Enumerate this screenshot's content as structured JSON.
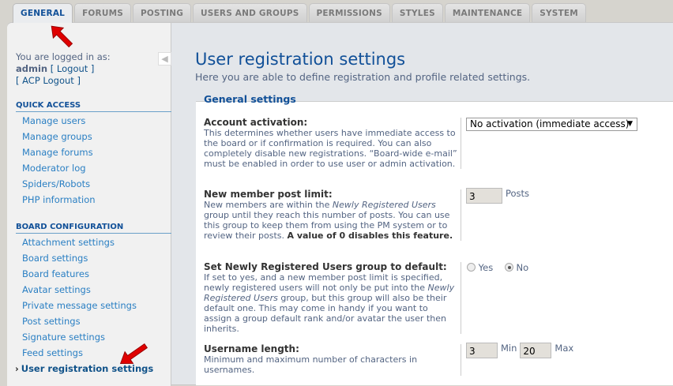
{
  "tabs": [
    "GENERAL",
    "FORUMS",
    "POSTING",
    "USERS AND GROUPS",
    "PERMISSIONS",
    "STYLES",
    "MAINTENANCE",
    "SYSTEM"
  ],
  "login": {
    "prefix": "You are logged in as:",
    "user": "admin",
    "logout": "[ Logout ]",
    "acp_logout": "[ ACP Logout ]"
  },
  "sidebar": {
    "quick_access": {
      "title": "QUICK ACCESS",
      "items": [
        "Manage users",
        "Manage groups",
        "Manage forums",
        "Moderator log",
        "Spiders/Robots",
        "PHP information"
      ]
    },
    "board_config": {
      "title": "BOARD CONFIGURATION",
      "items": [
        "Attachment settings",
        "Board settings",
        "Board features",
        "Avatar settings",
        "Private message settings",
        "Post settings",
        "Signature settings",
        "Feed settings",
        "User registration settings"
      ]
    }
  },
  "main": {
    "title": "User registration settings",
    "intro": "Here you are able to define registration and profile related settings.",
    "legend": "General settings",
    "account_activation": {
      "label": "Account activation:",
      "desc": "This determines whether users have immediate access to the board or if confirmation is required. You can also completely disable new registrations. “Board-wide e-mail” must be enabled in order to use user or admin activation.",
      "value": "No activation (immediate access)"
    },
    "post_limit": {
      "label": "New member post limit:",
      "desc1": "New members are within the ",
      "desc_em": "Newly Registered Users",
      "desc2": " group until they reach this number of posts. You can use this group to keep them from using the PM system or to review their posts. ",
      "desc_b": "A value of 0 disables this feature.",
      "value": "3",
      "unit": "Posts"
    },
    "nru_default": {
      "label": "Set Newly Registered Users group to default:",
      "desc1": "If set to yes, and a new member post limit is specified, newly registered users will not only be put into the ",
      "desc_em": "Newly Registered Users",
      "desc2": " group, but this group will also be their default one. This may come in handy if you want to assign a group default rank and/or avatar the user then inherits.",
      "yes": "Yes",
      "no": "No",
      "selected": "No"
    },
    "username_length": {
      "label": "Username length:",
      "desc": "Minimum and maximum number of characters in usernames.",
      "min": "3",
      "min_label": "Min",
      "max": "20",
      "max_label": "Max"
    }
  },
  "colors": {
    "accent": "#115098",
    "link": "#2a7fc3",
    "annotation_arrow": "#e00000"
  }
}
